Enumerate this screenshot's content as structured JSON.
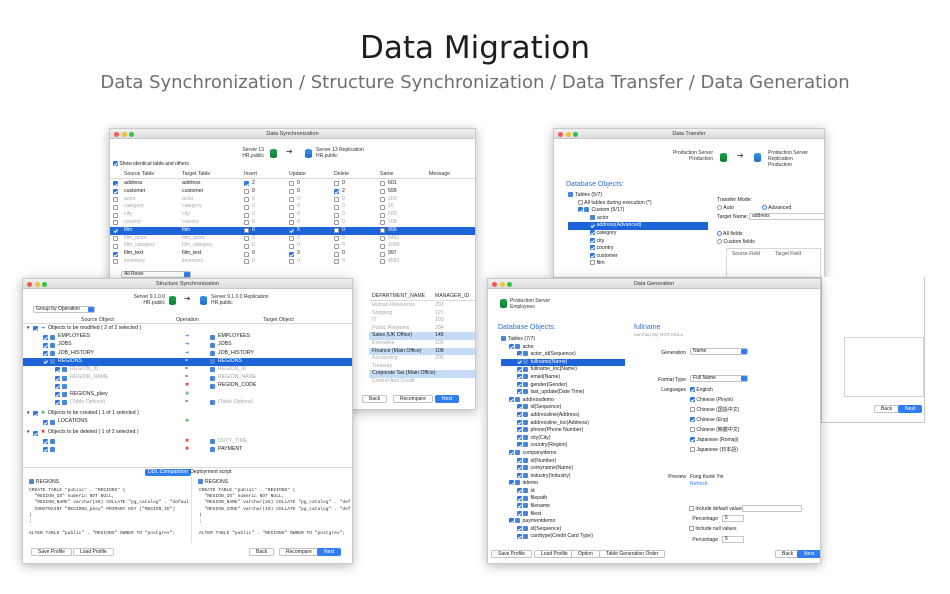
{
  "hero": {
    "title": "Data Migration",
    "subtitle": "Data Synchronization / Structure Synchronization / Data Transfer / Data Generation"
  },
  "ds": {
    "title": "Data Synchronization",
    "src": [
      "Server 13",
      "HR.public"
    ],
    "tgt": [
      "Server 13 Replication",
      "HR.public"
    ],
    "show_identical": "Show identical table and others",
    "cols": [
      "Source Table",
      "Target Table",
      "Insert",
      "Update",
      "Delete",
      "Same",
      "Message"
    ],
    "rows": [
      [
        "address",
        "address",
        "2",
        "0",
        "0",
        "601"
      ],
      [
        "customer",
        "customer",
        "0",
        "0",
        "2",
        "599"
      ],
      [
        "actor",
        "actor",
        "0",
        "0",
        "0",
        "200"
      ],
      [
        "category",
        "category",
        "0",
        "0",
        "0",
        "16"
      ],
      [
        "city",
        "city",
        "0",
        "0",
        "0",
        "600"
      ],
      [
        "country",
        "country",
        "0",
        "0",
        "0",
        "109"
      ],
      [
        "film",
        "film",
        "0",
        "5",
        "0",
        "995"
      ],
      [
        "film_actor",
        "film_actor",
        "0",
        "0",
        "0",
        "5462"
      ],
      [
        "film_category",
        "film_category",
        "0",
        "0",
        "0",
        "1000"
      ],
      [
        "film_text",
        "film_text",
        "0",
        "3",
        "0",
        "997"
      ],
      [
        "inventory",
        "inventory",
        "0",
        "0",
        "0",
        "4581"
      ]
    ],
    "filter": "All Rows",
    "right_cols": [
      "DEPARTMENT_NAME",
      "MANAGER_ID"
    ],
    "right_rows": [
      [
        "Human Resources",
        "203"
      ],
      [
        "Shipping",
        "121"
      ],
      [
        "IT",
        "103"
      ],
      [
        "Public Relations",
        "204"
      ],
      [
        "Sales (UK Office)",
        "145"
      ],
      [
        "Executive",
        "100"
      ],
      [
        "Finance (Main Office)",
        "108"
      ],
      [
        "Accounting",
        "205"
      ],
      [
        "Treasury",
        ""
      ],
      [
        "Corporate Tax (Main Office)",
        ""
      ],
      [
        "Control And Credit",
        ""
      ]
    ],
    "back": "Back",
    "recompare": "Recompare",
    "next": "Next"
  },
  "ss": {
    "title": "Structure Synchronization",
    "group": "Group by Operation",
    "src": [
      "Server 9.1.0.0",
      "HR.public"
    ],
    "tgt": [
      "Server 9.1.0.0 Replication",
      "HR.public"
    ],
    "cols": [
      "Source Object",
      "Operation",
      "Target Object"
    ],
    "sec_mod": "Objects to be modified ( 2 of 2 selected )",
    "mod": [
      [
        "EMPLOYEES",
        "EMPLOYEES"
      ],
      [
        "JOBS",
        "JOBS"
      ],
      [
        "JOB_HISTORY",
        "JOB_HISTORY"
      ],
      [
        "REGIONS",
        "REGIONS"
      ]
    ],
    "sub": [
      [
        "REGION_ID",
        "REGION_ID"
      ],
      [
        "REGION_NAME",
        "REGION_NAME"
      ],
      [
        "",
        "REGION_CODE"
      ],
      [
        "REGIONS_pkey",
        ""
      ],
      [
        "(Table Options)",
        "(Table Options)"
      ]
    ],
    "sec_create": "Objects to be created ( 1 of 1 selected )",
    "create": "LOCATIONS",
    "sec_del": "Objects to be deleted ( 1 of 2 selected )",
    "del": [
      "DUTY_TIME",
      "PAYMENT"
    ],
    "tab1": "DDL Comparison",
    "tab2": "Deployment script",
    "ddl_name": "REGIONS",
    "code_left": "CREATE TABLE \"public\" . \"REGIONS\" (\n  \"REGION_ID\" numeric NOT NULL,\n  \"REGION_NAME\" varchar(25) COLLATE \"pg_catalog\" . \"default\",\n  CONSTRAINT \"REGIONS_pkey\" PRIMARY KEY (\"REGION_ID\")\n)\n;\n\nALTER TABLE \"public\" . \"REGIONS\" OWNER TO \"postgres\";",
    "code_right": "CREATE TABLE \"public\" . \"REGIONS\" (\n  \"REGION_ID\" numeric NOT NULL,\n  \"REGION_NAME\" varchar(25) COLLATE \"pg_catalog\" . \"default\",\n  \"REGION_CODE\" varchar(10) COLLATE \"pg_catalog\" . \"default\",\n)\n;\n\nALTER TABLE \"public\" . \"REGIONS\" OWNER TO \"postgres\";",
    "save": "Save Profile",
    "load": "Load Profile",
    "back": "Back",
    "recompare": "Recompare",
    "next": "Next"
  },
  "dt": {
    "title": "Data Transfer",
    "src": [
      "Production Server",
      "Production"
    ],
    "tgt": [
      "Production Server Replication",
      "Production"
    ],
    "db_objects": "Database Objects:",
    "tree": [
      "Tables (5/7)",
      "All tables during execution (*)",
      "Custom (5/17)",
      "actor",
      "address(Advanced)",
      "category",
      "city",
      "country",
      "customer",
      "film"
    ],
    "mode_label": "Transfer Mode:",
    "auto": "Auto",
    "advanced": "Advanced",
    "target_name_label": "Target Name:",
    "target_name": "address",
    "all_fields": "All fields",
    "custom_fields": "Custom fields",
    "src_field": "Source Field",
    "tgt_field": "Target Field",
    "back": "Back",
    "next": "Next"
  },
  "dg": {
    "title": "Data Generation",
    "src": [
      "Production Server",
      "Employees"
    ],
    "db_objects": "Database Objects:",
    "tree": [
      "Tables (7/7)",
      "actor",
      "actor_id(Sequence)",
      "fullname(Name)",
      "fullname_loc(Name)",
      "email(Name)",
      "gender(Gender)",
      "last_update(Date Time)",
      "addressdemo",
      "id(Sequence)",
      "addressline(Address)",
      "addressline_loc(Address)",
      "phone(Phone Number)",
      "city(City)",
      "country(Region)",
      "companydemo",
      "id(Number)",
      "comyname(Name)",
      "industry(Industry)",
      "itdemo",
      "id",
      "filepath",
      "filename",
      "filext",
      "paymentdemo",
      "id(Sequence)",
      "cardtype(Credit Card Type)"
    ],
    "field_name": "fullname",
    "field_type": "varchar(45) NOT NULL",
    "gen_label": "Generation",
    "gen_val": "Name",
    "fmt_label": "Format Type",
    "fmt_val": "Full Name",
    "lang_label": "Languages",
    "langs": [
      "English",
      "Chinese (Pinyin)",
      "Chinese (国語中文)",
      "Chinese (Eng)",
      "Chinese (簡體中文)",
      "Japanese (Romaji)",
      "Japanese (日本語)"
    ],
    "preview_label": "Preview",
    "preview_val": "Fong Kwok Yin",
    "refresh": "Refresh",
    "incl_default": "Include default values",
    "pct_label": "Percentage",
    "pct_val": "5",
    "incl_null": "Include null values",
    "pct2_val": "5",
    "save": "Save Profile",
    "load": "Load Profile",
    "option": "Option",
    "order": "Table Generation Order",
    "back": "Back",
    "next": "Next"
  }
}
